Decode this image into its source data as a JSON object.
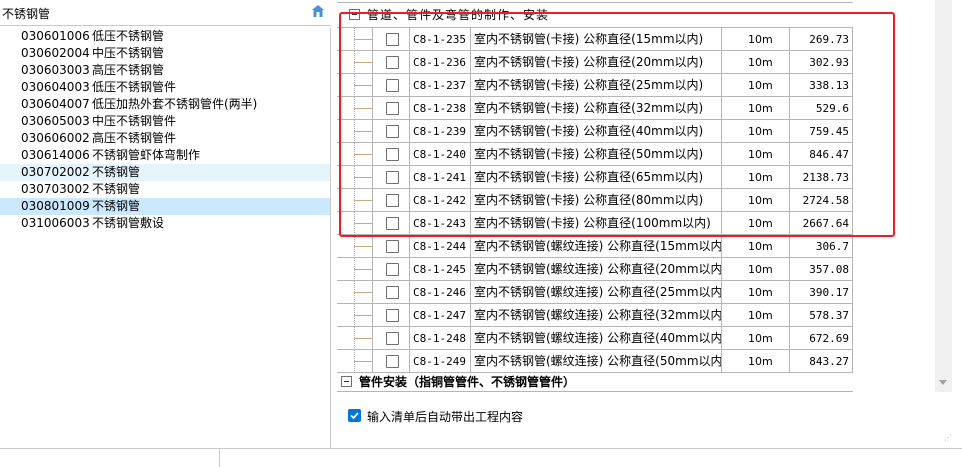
{
  "left_panel": {
    "title": "不锈钢管",
    "items": [
      {
        "code": "030601006",
        "name": "低压不锈钢管",
        "state": "normal"
      },
      {
        "code": "030602004",
        "name": "中压不锈钢管",
        "state": "normal"
      },
      {
        "code": "030603003",
        "name": "高压不锈钢管",
        "state": "normal"
      },
      {
        "code": "030604003",
        "name": "低压不锈钢管件",
        "state": "normal"
      },
      {
        "code": "030604007",
        "name": "低压加热外套不锈钢管件(两半)",
        "state": "normal"
      },
      {
        "code": "030605003",
        "name": "中压不锈钢管件",
        "state": "normal"
      },
      {
        "code": "030606002",
        "name": "高压不锈钢管件",
        "state": "normal"
      },
      {
        "code": "030614006",
        "name": "不锈钢管虾体弯制作",
        "state": "normal"
      },
      {
        "code": "030702002",
        "name": "不锈钢管",
        "state": "hover"
      },
      {
        "code": "030703002",
        "name": "不锈钢管",
        "state": "normal"
      },
      {
        "code": "030801009",
        "name": "不锈钢管",
        "state": "selected"
      },
      {
        "code": "031006003",
        "name": "不锈钢管敷设",
        "state": "normal"
      }
    ]
  },
  "grid": {
    "top_group_label": "管道、管件及弯管的制作、安装",
    "rows": [
      {
        "code": "C8-1-235",
        "name": "室内不锈钢管(卡接) 公称直径(15mm以内)",
        "unit": "10m",
        "price": "269.73"
      },
      {
        "code": "C8-1-236",
        "name": "室内不锈钢管(卡接) 公称直径(20mm以内)",
        "unit": "10m",
        "price": "302.93"
      },
      {
        "code": "C8-1-237",
        "name": "室内不锈钢管(卡接) 公称直径(25mm以内)",
        "unit": "10m",
        "price": "338.13"
      },
      {
        "code": "C8-1-238",
        "name": "室内不锈钢管(卡接) 公称直径(32mm以内)",
        "unit": "10m",
        "price": "529.6"
      },
      {
        "code": "C8-1-239",
        "name": "室内不锈钢管(卡接) 公称直径(40mm以内)",
        "unit": "10m",
        "price": "759.45"
      },
      {
        "code": "C8-1-240",
        "name": "室内不锈钢管(卡接) 公称直径(50mm以内)",
        "unit": "10m",
        "price": "846.47"
      },
      {
        "code": "C8-1-241",
        "name": "室内不锈钢管(卡接) 公称直径(65mm以内)",
        "unit": "10m",
        "price": "2138.73"
      },
      {
        "code": "C8-1-242",
        "name": "室内不锈钢管(卡接) 公称直径(80mm以内)",
        "unit": "10m",
        "price": "2724.58"
      },
      {
        "code": "C8-1-243",
        "name": "室内不锈钢管(卡接) 公称直径(100mm以内)",
        "unit": "10m",
        "price": "2667.64"
      },
      {
        "code": "C8-1-244",
        "name": "室内不锈钢管(螺纹连接) 公称直径(15mm以内)",
        "unit": "10m",
        "price": "306.7"
      },
      {
        "code": "C8-1-245",
        "name": "室内不锈钢管(螺纹连接) 公称直径(20mm以内)",
        "unit": "10m",
        "price": "357.08"
      },
      {
        "code": "C8-1-246",
        "name": "室内不锈钢管(螺纹连接) 公称直径(25mm以内)",
        "unit": "10m",
        "price": "390.17"
      },
      {
        "code": "C8-1-247",
        "name": "室内不锈钢管(螺纹连接) 公称直径(32mm以内)",
        "unit": "10m",
        "price": "578.37"
      },
      {
        "code": "C8-1-248",
        "name": "室内不锈钢管(螺纹连接) 公称直径(40mm以内)",
        "unit": "10m",
        "price": "672.69"
      },
      {
        "code": "C8-1-249",
        "name": "室内不锈钢管(螺纹连接) 公称直径(50mm以内)",
        "unit": "10m",
        "price": "843.27"
      }
    ],
    "group2_label": "管件安装（指铜管管件、不锈钢管管件）"
  },
  "auto_option": {
    "label": "输入清单后自动带出工程内容",
    "checked": true
  },
  "colors": {
    "highlight": "#ee1c24",
    "selected_row": "#cce8ff",
    "hover_row": "#e5f3fb",
    "checkbox_checked": "#0078d7"
  }
}
